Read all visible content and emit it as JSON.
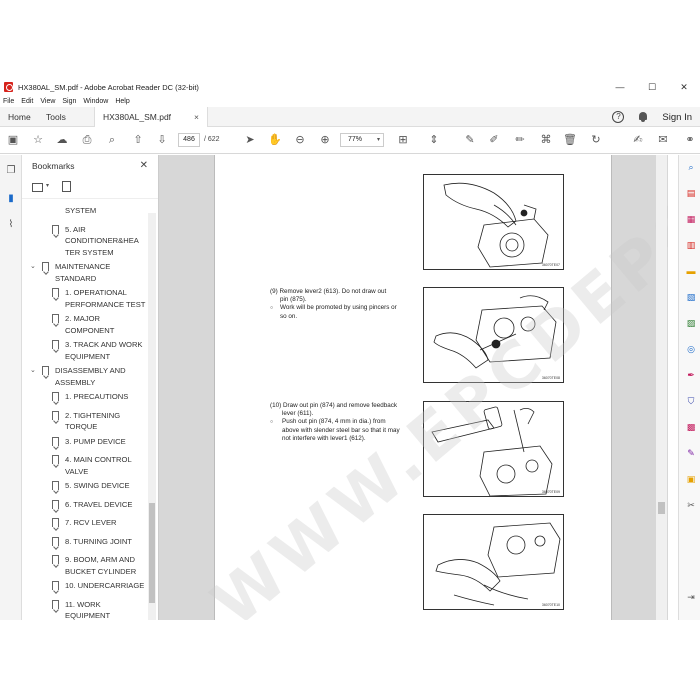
{
  "window": {
    "title": "HX380AL_SM.pdf - Adobe Acrobat Reader DC (32-bit)",
    "controls": {
      "minimize": "—",
      "maximize": "☐",
      "close": "✕"
    }
  },
  "menu": [
    "File",
    "Edit",
    "View",
    "Sign",
    "Window",
    "Help"
  ],
  "tabs": {
    "home": "Home",
    "tools": "Tools",
    "document": "HX380AL_SM.pdf",
    "close": "×"
  },
  "account": {
    "help": "?",
    "sign_in": "Sign In"
  },
  "toolbar": {
    "page_current": "486",
    "page_total": "/ 622",
    "zoom": "77%",
    "zoom_dropdown": "▾"
  },
  "bookmarks": {
    "title": "Bookmarks",
    "close": "✕",
    "items": [
      {
        "label": "SYSTEM",
        "level": 2,
        "lines": 1
      },
      {
        "label": "5. AIR CONDITIONER&HEATER SYSTEM",
        "level": 2,
        "lines": 3,
        "line_texts": [
          "5. AIR",
          "CONDITIONER&HEA",
          "TER SYSTEM"
        ]
      },
      {
        "label": "MAINTENANCE STANDARD",
        "level": 1,
        "lines": 2,
        "line_texts": [
          "MAINTENANCE",
          "STANDARD"
        ],
        "expanded": true
      },
      {
        "label": "1. OPERATIONAL PERFORMANCE TEST",
        "level": 2,
        "lines": 2,
        "line_texts": [
          "1. OPERATIONAL",
          "PERFORMANCE TEST"
        ]
      },
      {
        "label": "2. MAJOR COMPONENT",
        "level": 2,
        "lines": 2,
        "line_texts": [
          "2. MAJOR",
          "COMPONENT"
        ]
      },
      {
        "label": "3. TRACK AND WORK EQUIPMENT",
        "level": 2,
        "lines": 2,
        "line_texts": [
          "3. TRACK AND WORK",
          "EQUIPMENT"
        ]
      },
      {
        "label": "DISASSEMBLY AND ASSEMBLY",
        "level": 1,
        "lines": 2,
        "line_texts": [
          "DISASSEMBLY AND",
          "ASSEMBLY"
        ],
        "expanded": true
      },
      {
        "label": "1. PRECAUTIONS",
        "level": 2,
        "lines": 1
      },
      {
        "label": "2. TIGHTENING TORQUE",
        "level": 2,
        "lines": 2,
        "line_texts": [
          "2. TIGHTENING",
          "TORQUE"
        ]
      },
      {
        "label": "3. PUMP DEVICE",
        "level": 2,
        "lines": 1
      },
      {
        "label": "4. MAIN CONTROL VALVE",
        "level": 2,
        "lines": 2,
        "line_texts": [
          "4. MAIN CONTROL",
          "VALVE"
        ]
      },
      {
        "label": "5. SWING DEVICE",
        "level": 2,
        "lines": 1
      },
      {
        "label": "6. TRAVEL DEVICE",
        "level": 2,
        "lines": 1
      },
      {
        "label": "7. RCV LEVER",
        "level": 2,
        "lines": 1
      },
      {
        "label": "8. TURNING JOINT",
        "level": 2,
        "lines": 1
      },
      {
        "label": "9. BOOM, ARM AND BUCKET CYLINDER",
        "level": 2,
        "lines": 2,
        "line_texts": [
          "9. BOOM, ARM AND",
          "BUCKET CYLINDER"
        ]
      },
      {
        "label": "10. UNDERCARRIAGE",
        "level": 2,
        "lines": 1
      },
      {
        "label": "11. WORK EQUIPMENT",
        "level": 2,
        "lines": 2,
        "line_texts": [
          "11. WORK",
          "EQUIPMENT"
        ]
      }
    ]
  },
  "page_content": {
    "steps": [
      {
        "number": "(9)",
        "text": "Remove lever2 (613).   Do not draw out pin (875).",
        "lines": [
          "Remove lever2 (613).   Do not draw out",
          "pin (875)."
        ],
        "notes": [
          [
            "Work will be promoted by using pincers or",
            "so on."
          ]
        ]
      },
      {
        "number": "(10)",
        "text": "Draw out pin (874) and remove feedback lever (611).",
        "lines": [
          "Draw out pin (874) and remove feedback",
          "lever (611)."
        ],
        "notes": [
          [
            "Push out pin (874, 4 mm in dia.) from",
            "above with slender steel bar so that it may",
            "not interfere with lever1 (612)."
          ]
        ]
      }
    ],
    "figure_codes": [
      "36070TE07",
      "36070TE08",
      "36070TE09",
      "36070TE10"
    ],
    "watermark": "WWW.EPCDEPO.COM"
  },
  "colors": {
    "accent": "#1b6ac9",
    "acrobat_red": "#d6231c",
    "doc_bg": "#d7d7d7"
  }
}
